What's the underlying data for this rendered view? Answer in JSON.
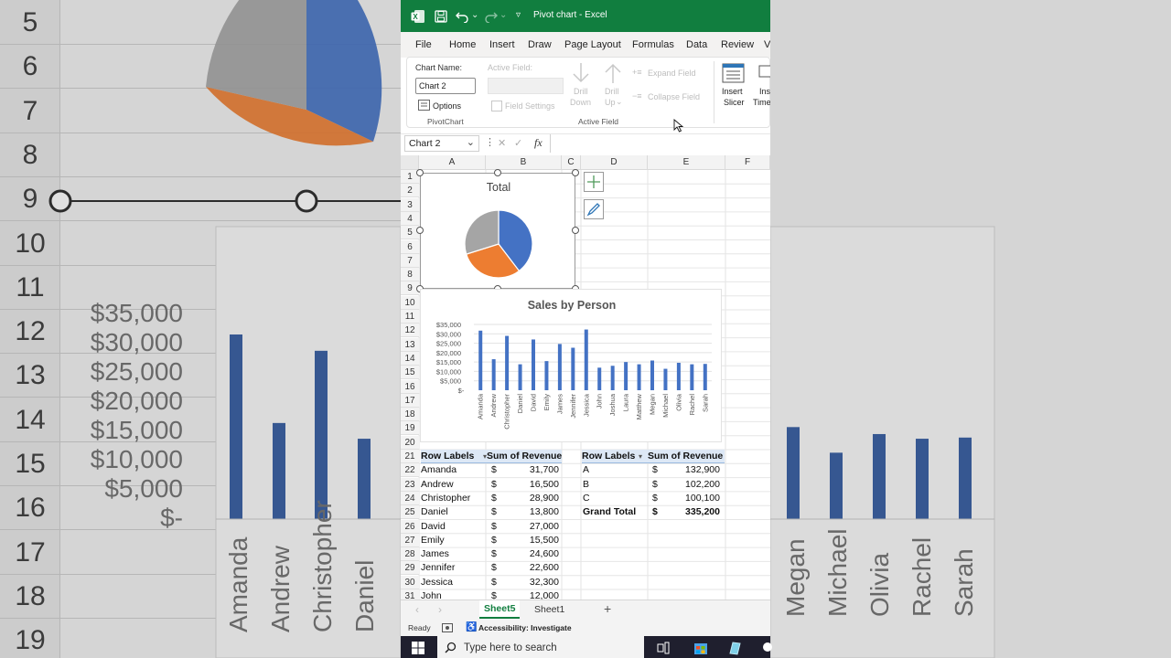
{
  "window": {
    "title": "Pivot chart",
    "app": "Excel",
    "separator": "-"
  },
  "menu": [
    "File",
    "Home",
    "Insert",
    "Draw",
    "Page Layout",
    "Formulas",
    "Data",
    "Review",
    "V"
  ],
  "ribbon": {
    "chart_name_label": "Chart Name:",
    "chart_name_value": "Chart 2",
    "options_label": "Options",
    "pivotchart_group": "PivotChart",
    "active_field_label": "Active Field:",
    "field_settings": "Field Settings",
    "drill_down": [
      "Drill",
      "Down"
    ],
    "drill_up": [
      "Drill",
      "Up"
    ],
    "expand_field": "Expand Field",
    "collapse_field": "Collapse Field",
    "active_field_group": "Active Field",
    "insert_slicer": [
      "Insert",
      "Slicer"
    ],
    "insert_timeline": [
      "Ins",
      "Time"
    ]
  },
  "formula_bar": {
    "name_box": "Chart 2",
    "fx": "fx",
    "cancel": "✕",
    "enter": "✓"
  },
  "columns": [
    "A",
    "B",
    "C",
    "D",
    "E",
    "F"
  ],
  "row_numbers": [
    "1",
    "2",
    "3",
    "4",
    "5",
    "6",
    "7",
    "8",
    "9",
    "10",
    "11",
    "12",
    "13",
    "14",
    "15",
    "16",
    "17",
    "18",
    "19",
    "20",
    "21",
    "22",
    "23",
    "24",
    "25",
    "26",
    "27",
    "28",
    "29",
    "30",
    "31"
  ],
  "table1": {
    "headers": [
      "Row Labels",
      "Sum of Revenue"
    ],
    "rows": [
      [
        "Amanda",
        "$",
        "31,700"
      ],
      [
        "Andrew",
        "$",
        "16,500"
      ],
      [
        "Christopher",
        "$",
        "28,900"
      ],
      [
        "Daniel",
        "$",
        "13,800"
      ],
      [
        "David",
        "$",
        "27,000"
      ],
      [
        "Emily",
        "$",
        "15,500"
      ],
      [
        "James",
        "$",
        "24,600"
      ],
      [
        "Jennifer",
        "$",
        "22,600"
      ],
      [
        "Jessica",
        "$",
        "32,300"
      ],
      [
        "John",
        "$",
        "12,000"
      ]
    ]
  },
  "table2": {
    "headers": [
      "Row Labels",
      "Sum of Revenue"
    ],
    "rows": [
      [
        "A",
        "$",
        "132,900"
      ],
      [
        "B",
        "$",
        "102,200"
      ],
      [
        "C",
        "$",
        "100,100"
      ]
    ],
    "total": [
      "Grand Total",
      "$",
      "335,200"
    ]
  },
  "sheets": {
    "active": "Sheet5",
    "other": "Sheet1",
    "add": "+"
  },
  "status": {
    "ready": "Ready",
    "accessibility": "Accessibility: Investigate"
  },
  "taskbar": {
    "search_placeholder": "Type here to search"
  },
  "colors": {
    "excel_green": "#117e3f",
    "bar_blue": "#4472c4",
    "pie_orange": "#ed7d31",
    "pie_gray": "#a5a5a5"
  },
  "chart_data": [
    {
      "type": "pie",
      "title": "Total",
      "categories": [
        "A",
        "B",
        "C"
      ],
      "values": [
        132900,
        102200,
        100100
      ]
    },
    {
      "type": "bar",
      "title": "Sales by Person",
      "categories": [
        "Amanda",
        "Andrew",
        "Christopher",
        "Daniel",
        "David",
        "Emily",
        "James",
        "Jennifer",
        "Jessica",
        "John",
        "Joshua",
        "Laura",
        "Matthew",
        "Megan",
        "Michael",
        "Olivia",
        "Rachel",
        "Sarah"
      ],
      "values": [
        31700,
        16500,
        28900,
        13800,
        27000,
        15500,
        24600,
        22600,
        32300,
        12000,
        13000,
        15000,
        13800,
        15800,
        11400,
        14600,
        13800,
        14000
      ],
      "yticks": [
        "$35,000",
        "$30,000",
        "$25,000",
        "$20,000",
        "$15,000",
        "$10,000",
        "$5,000",
        "$-"
      ],
      "ylim": [
        0,
        35000
      ],
      "grid": true
    }
  ],
  "background": {
    "left_rows": [
      "5",
      "6",
      "7",
      "8",
      "9",
      "10",
      "11",
      "12",
      "13",
      "14",
      "15",
      "16",
      "17",
      "18",
      "19"
    ],
    "left_yticks": [
      "$35,000",
      "$30,000",
      "$25,000",
      "$20,000",
      "$15,000",
      "$10,000",
      "$5,000",
      "$-"
    ],
    "left_names": [
      "Amanda",
      "Andrew",
      "Christopher",
      "Daniel"
    ],
    "right_names": [
      "Megan",
      "Michael",
      "Olivia",
      "Rachel",
      "Sarah"
    ]
  }
}
